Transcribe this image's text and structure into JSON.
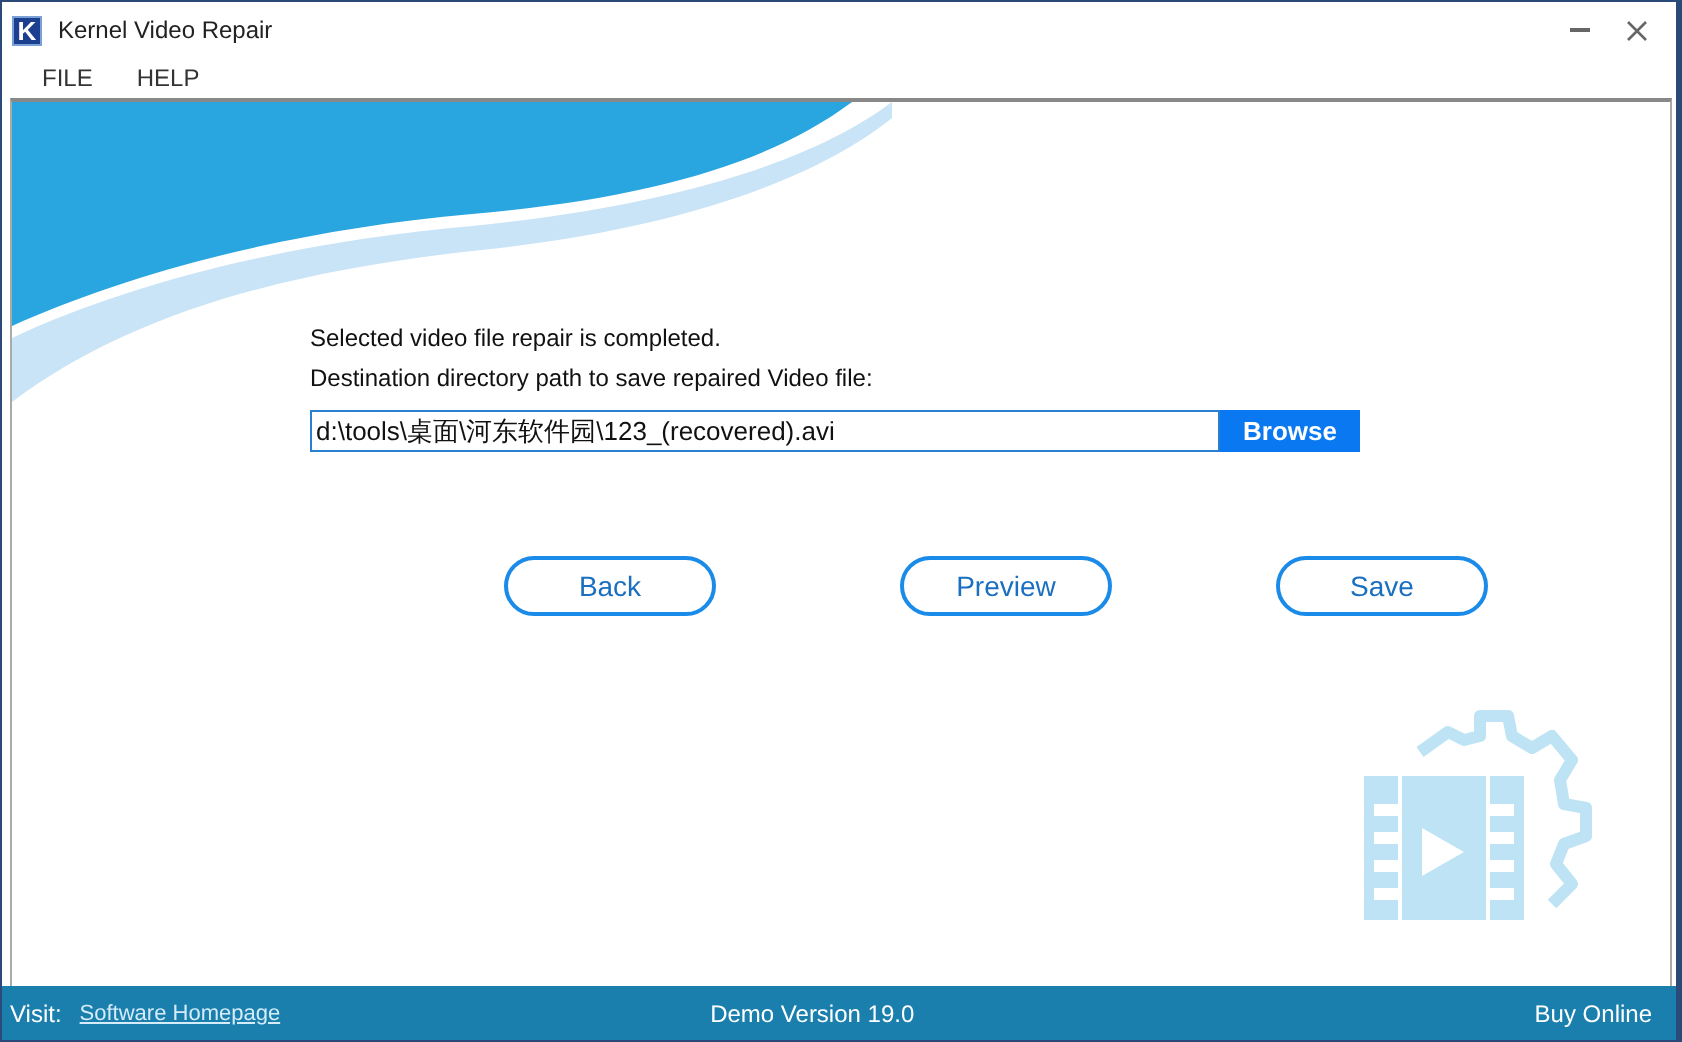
{
  "window": {
    "logo": "K",
    "title": "Kernel Video Repair"
  },
  "menu": [
    "FILE",
    "HELP"
  ],
  "message": {
    "status": "Selected video file repair is completed.",
    "prompt": "Destination directory path to save repaired Video file:"
  },
  "destination": {
    "value": "d:\\tools\\桌面\\河东软件园\\123_(recovered).avi",
    "browse": "Browse"
  },
  "buttons": [
    "Back",
    "Preview",
    "Save"
  ],
  "status_bar": {
    "visit_label": "Visit:",
    "link": "Software Homepage",
    "version": "Demo Version 19.0",
    "buy": "Buy Online"
  }
}
